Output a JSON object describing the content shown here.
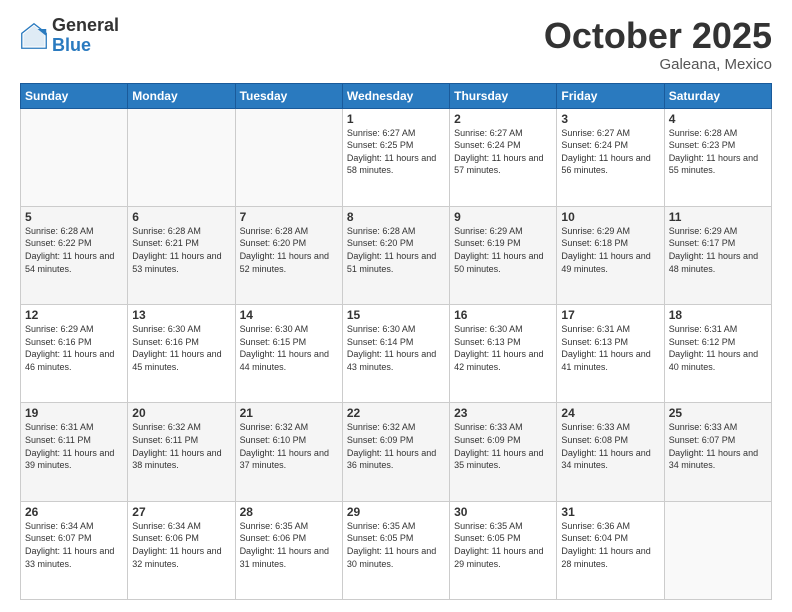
{
  "header": {
    "logo_general": "General",
    "logo_blue": "Blue",
    "month_title": "October 2025",
    "location": "Galeana, Mexico"
  },
  "days_of_week": [
    "Sunday",
    "Monday",
    "Tuesday",
    "Wednesday",
    "Thursday",
    "Friday",
    "Saturday"
  ],
  "weeks": [
    [
      {
        "day": "",
        "sunrise": "",
        "sunset": "",
        "daylight": "",
        "empty": true
      },
      {
        "day": "",
        "sunrise": "",
        "sunset": "",
        "daylight": "",
        "empty": true
      },
      {
        "day": "",
        "sunrise": "",
        "sunset": "",
        "daylight": "",
        "empty": true
      },
      {
        "day": "1",
        "sunrise": "Sunrise: 6:27 AM",
        "sunset": "Sunset: 6:25 PM",
        "daylight": "Daylight: 11 hours and 58 minutes."
      },
      {
        "day": "2",
        "sunrise": "Sunrise: 6:27 AM",
        "sunset": "Sunset: 6:24 PM",
        "daylight": "Daylight: 11 hours and 57 minutes."
      },
      {
        "day": "3",
        "sunrise": "Sunrise: 6:27 AM",
        "sunset": "Sunset: 6:24 PM",
        "daylight": "Daylight: 11 hours and 56 minutes."
      },
      {
        "day": "4",
        "sunrise": "Sunrise: 6:28 AM",
        "sunset": "Sunset: 6:23 PM",
        "daylight": "Daylight: 11 hours and 55 minutes."
      }
    ],
    [
      {
        "day": "5",
        "sunrise": "Sunrise: 6:28 AM",
        "sunset": "Sunset: 6:22 PM",
        "daylight": "Daylight: 11 hours and 54 minutes."
      },
      {
        "day": "6",
        "sunrise": "Sunrise: 6:28 AM",
        "sunset": "Sunset: 6:21 PM",
        "daylight": "Daylight: 11 hours and 53 minutes."
      },
      {
        "day": "7",
        "sunrise": "Sunrise: 6:28 AM",
        "sunset": "Sunset: 6:20 PM",
        "daylight": "Daylight: 11 hours and 52 minutes."
      },
      {
        "day": "8",
        "sunrise": "Sunrise: 6:28 AM",
        "sunset": "Sunset: 6:20 PM",
        "daylight": "Daylight: 11 hours and 51 minutes."
      },
      {
        "day": "9",
        "sunrise": "Sunrise: 6:29 AM",
        "sunset": "Sunset: 6:19 PM",
        "daylight": "Daylight: 11 hours and 50 minutes."
      },
      {
        "day": "10",
        "sunrise": "Sunrise: 6:29 AM",
        "sunset": "Sunset: 6:18 PM",
        "daylight": "Daylight: 11 hours and 49 minutes."
      },
      {
        "day": "11",
        "sunrise": "Sunrise: 6:29 AM",
        "sunset": "Sunset: 6:17 PM",
        "daylight": "Daylight: 11 hours and 48 minutes."
      }
    ],
    [
      {
        "day": "12",
        "sunrise": "Sunrise: 6:29 AM",
        "sunset": "Sunset: 6:16 PM",
        "daylight": "Daylight: 11 hours and 46 minutes."
      },
      {
        "day": "13",
        "sunrise": "Sunrise: 6:30 AM",
        "sunset": "Sunset: 6:16 PM",
        "daylight": "Daylight: 11 hours and 45 minutes."
      },
      {
        "day": "14",
        "sunrise": "Sunrise: 6:30 AM",
        "sunset": "Sunset: 6:15 PM",
        "daylight": "Daylight: 11 hours and 44 minutes."
      },
      {
        "day": "15",
        "sunrise": "Sunrise: 6:30 AM",
        "sunset": "Sunset: 6:14 PM",
        "daylight": "Daylight: 11 hours and 43 minutes."
      },
      {
        "day": "16",
        "sunrise": "Sunrise: 6:30 AM",
        "sunset": "Sunset: 6:13 PM",
        "daylight": "Daylight: 11 hours and 42 minutes."
      },
      {
        "day": "17",
        "sunrise": "Sunrise: 6:31 AM",
        "sunset": "Sunset: 6:13 PM",
        "daylight": "Daylight: 11 hours and 41 minutes."
      },
      {
        "day": "18",
        "sunrise": "Sunrise: 6:31 AM",
        "sunset": "Sunset: 6:12 PM",
        "daylight": "Daylight: 11 hours and 40 minutes."
      }
    ],
    [
      {
        "day": "19",
        "sunrise": "Sunrise: 6:31 AM",
        "sunset": "Sunset: 6:11 PM",
        "daylight": "Daylight: 11 hours and 39 minutes."
      },
      {
        "day": "20",
        "sunrise": "Sunrise: 6:32 AM",
        "sunset": "Sunset: 6:11 PM",
        "daylight": "Daylight: 11 hours and 38 minutes."
      },
      {
        "day": "21",
        "sunrise": "Sunrise: 6:32 AM",
        "sunset": "Sunset: 6:10 PM",
        "daylight": "Daylight: 11 hours and 37 minutes."
      },
      {
        "day": "22",
        "sunrise": "Sunrise: 6:32 AM",
        "sunset": "Sunset: 6:09 PM",
        "daylight": "Daylight: 11 hours and 36 minutes."
      },
      {
        "day": "23",
        "sunrise": "Sunrise: 6:33 AM",
        "sunset": "Sunset: 6:09 PM",
        "daylight": "Daylight: 11 hours and 35 minutes."
      },
      {
        "day": "24",
        "sunrise": "Sunrise: 6:33 AM",
        "sunset": "Sunset: 6:08 PM",
        "daylight": "Daylight: 11 hours and 34 minutes."
      },
      {
        "day": "25",
        "sunrise": "Sunrise: 6:33 AM",
        "sunset": "Sunset: 6:07 PM",
        "daylight": "Daylight: 11 hours and 34 minutes."
      }
    ],
    [
      {
        "day": "26",
        "sunrise": "Sunrise: 6:34 AM",
        "sunset": "Sunset: 6:07 PM",
        "daylight": "Daylight: 11 hours and 33 minutes."
      },
      {
        "day": "27",
        "sunrise": "Sunrise: 6:34 AM",
        "sunset": "Sunset: 6:06 PM",
        "daylight": "Daylight: 11 hours and 32 minutes."
      },
      {
        "day": "28",
        "sunrise": "Sunrise: 6:35 AM",
        "sunset": "Sunset: 6:06 PM",
        "daylight": "Daylight: 11 hours and 31 minutes."
      },
      {
        "day": "29",
        "sunrise": "Sunrise: 6:35 AM",
        "sunset": "Sunset: 6:05 PM",
        "daylight": "Daylight: 11 hours and 30 minutes."
      },
      {
        "day": "30",
        "sunrise": "Sunrise: 6:35 AM",
        "sunset": "Sunset: 6:05 PM",
        "daylight": "Daylight: 11 hours and 29 minutes."
      },
      {
        "day": "31",
        "sunrise": "Sunrise: 6:36 AM",
        "sunset": "Sunset: 6:04 PM",
        "daylight": "Daylight: 11 hours and 28 minutes."
      },
      {
        "day": "",
        "sunrise": "",
        "sunset": "",
        "daylight": "",
        "empty": true
      }
    ]
  ]
}
